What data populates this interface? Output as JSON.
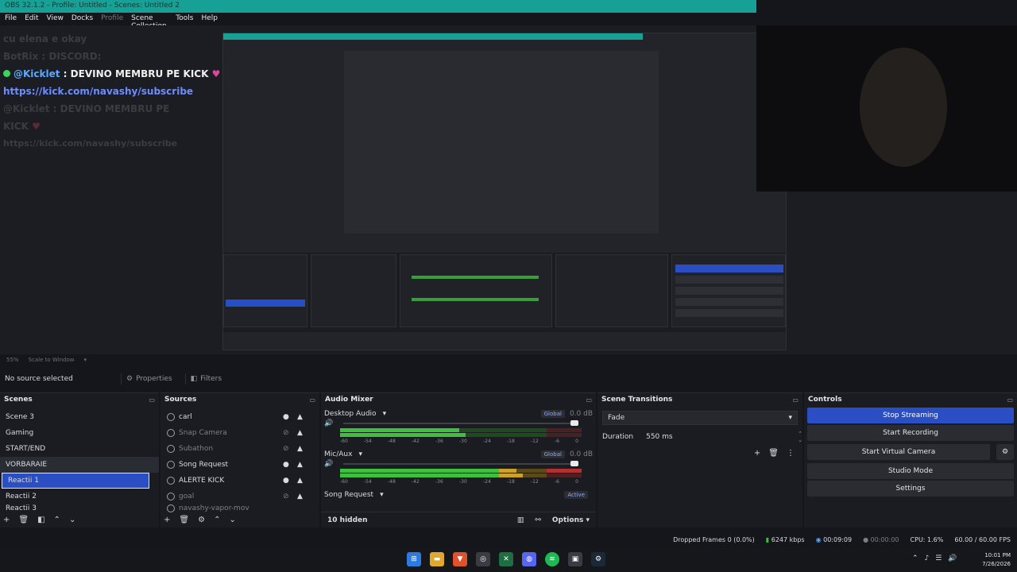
{
  "window": {
    "title": "OBS 32.1.2 - Profile: Untitled - Scenes: Untitled 2"
  },
  "menu": [
    "File",
    "Edit",
    "View",
    "Docks",
    "Profile",
    "Scene Collection",
    "Tools",
    "Help"
  ],
  "preview": {
    "chat": {
      "ghost_top": "cu elena e okay",
      "ghost_bot": "BotRix : DISCORD:",
      "user": "@Kicklet",
      "message": " : DEVINO MEMBRU PE KICK ",
      "link": "https://kick.com/navashy/subscribe",
      "ghost_user": "@Kicklet : DEVINO MEMBRU PE",
      "ghost_kick": "KICK",
      "ghost_link": "https://kick.com/navashy/subscribe"
    },
    "footer": {
      "zoom": "55%",
      "scale_mode": "Scale to Window"
    }
  },
  "source_bar": {
    "no_source": "No source selected",
    "properties": "Properties",
    "filters": "Filters"
  },
  "scenes": {
    "title": "Scenes",
    "items": [
      "Scene 3",
      "Gaming",
      "START/END",
      "VORBARAIE",
      "Reactii 1",
      "Reactii 2",
      "Reactii 3"
    ]
  },
  "sources": {
    "title": "Sources",
    "items": [
      {
        "name": "carl",
        "visible": true
      },
      {
        "name": "Snap Camera",
        "visible": false
      },
      {
        "name": "Subathon",
        "visible": false
      },
      {
        "name": "Song Request",
        "visible": true
      },
      {
        "name": "ALERTE KICK",
        "visible": true
      },
      {
        "name": "goal",
        "visible": false
      },
      {
        "name": "navashy-vapor-mov",
        "visible": false
      }
    ]
  },
  "mixer": {
    "title": "Audio Mixer",
    "channels": [
      {
        "name": "Desktop Audio",
        "tag": "Global",
        "db": "0.0 dB"
      },
      {
        "name": "Mic/Aux",
        "tag": "Global",
        "db": "0.0 dB"
      },
      {
        "name": "Song Request",
        "tag": "Active",
        "db": ""
      }
    ],
    "scale": [
      "-60",
      "-54",
      "-48",
      "-42",
      "-36",
      "-30",
      "-24",
      "-18",
      "-12",
      "-6",
      "0"
    ],
    "hidden": "10 hidden",
    "options": "Options"
  },
  "transitions": {
    "title": "Scene Transitions",
    "selected": "Fade",
    "duration_label": "Duration",
    "duration": "550 ms"
  },
  "controls": {
    "title": "Controls",
    "stop_streaming": "Stop Streaming",
    "start_recording": "Start Recording",
    "start_virtual_camera": "Start Virtual Camera",
    "studio_mode": "Studio Mode",
    "settings": "Settings"
  },
  "status": {
    "dropped": "Dropped Frames 0 (0.0%)",
    "bitrate": "6247 kbps",
    "stream_time": "00:09:09",
    "rec_time": "00:00:00",
    "cpu": "CPU: 1.6%",
    "fps": "60.00 / 60.00 FPS"
  },
  "taskbar": {
    "time": "10:01 PM",
    "date": "7/26/2026"
  },
  "colors": {
    "accent": "#2a4fc5",
    "titlebar": "#17a095",
    "meter_green": "#3fbf3f",
    "meter_yellow": "#c9a12b",
    "meter_red": "#b33030"
  }
}
